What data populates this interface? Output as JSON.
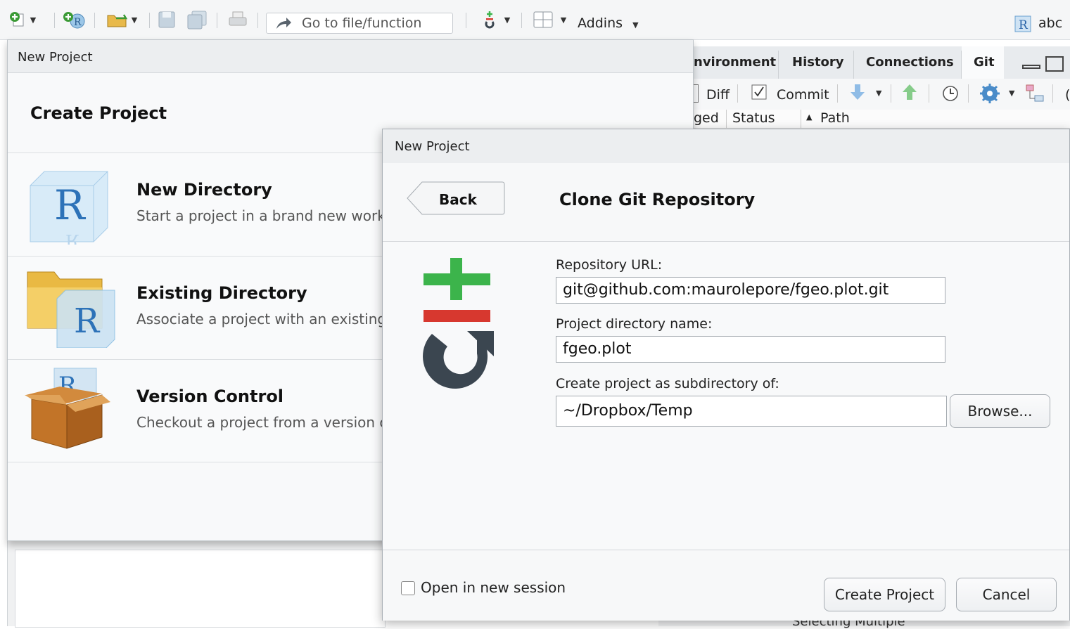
{
  "toolbar": {
    "goto_placeholder": "Go to file/function",
    "addins_label": "Addins",
    "user_label": "abc"
  },
  "right_pane": {
    "tabs": [
      "nvironment",
      "History",
      "Connections",
      "Git"
    ],
    "tools": {
      "diff": "Diff",
      "commit": "Commit",
      "more": "("
    },
    "columns": {
      "staged": "ged",
      "status": "Status",
      "path": "Path"
    },
    "bottom_text": "Selecting Multiple"
  },
  "create_dialog": {
    "window_title": "New Project",
    "heading": "Create Project",
    "options": [
      {
        "title": "New Directory",
        "desc": "Start a project in a brand new worki"
      },
      {
        "title": "Existing Directory",
        "desc": "Associate a project with an existing"
      },
      {
        "title": "Version Control",
        "desc": "Checkout a project from a version co"
      }
    ]
  },
  "clone_dialog": {
    "window_title": "New Project",
    "back_label": "Back",
    "heading": "Clone Git Repository",
    "repo_url_label": "Repository URL:",
    "repo_url_value": "git@github.com:maurolepore/fgeo.plot.git",
    "dir_name_label": "Project directory name:",
    "dir_name_value": "fgeo.plot",
    "subdir_label": "Create project as subdirectory of:",
    "subdir_value": "~/Dropbox/Temp",
    "browse_label": "Browse...",
    "open_new_session_label": "Open in new session",
    "open_new_session_checked": false,
    "create_label": "Create Project",
    "cancel_label": "Cancel"
  },
  "colors": {
    "git_green": "#3cb44b",
    "git_red": "#d7382f",
    "git_dark": "#3b4650"
  }
}
